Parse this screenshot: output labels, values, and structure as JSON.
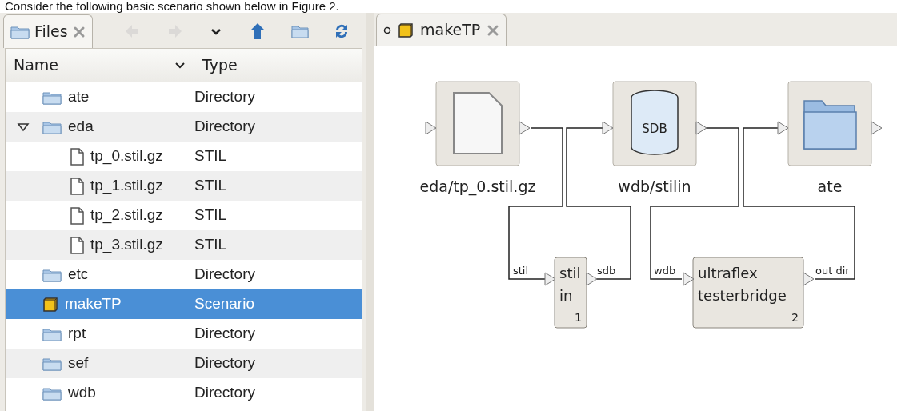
{
  "caption": "Consider the following basic scenario shown below in Figure 2.",
  "files_panel": {
    "tab": {
      "label": "Files"
    },
    "toolbar": [
      {
        "kind": "back",
        "disabled": true
      },
      {
        "kind": "forward",
        "disabled": true
      },
      {
        "kind": "dropdown",
        "disabled": false
      },
      {
        "kind": "up",
        "disabled": false
      },
      {
        "kind": "folder",
        "disabled": false
      },
      {
        "kind": "refresh",
        "disabled": false
      }
    ],
    "columns": [
      "Name",
      "Type"
    ],
    "rows": [
      {
        "name": "ate",
        "type": "Directory",
        "kind": "folder",
        "selected": false
      },
      {
        "name": "eda",
        "type": "Directory",
        "kind": "folder",
        "selected": false,
        "expanded": true,
        "children": [
          {
            "name": "tp_0.stil.gz",
            "type": "STIL",
            "kind": "file",
            "selected": false
          },
          {
            "name": "tp_1.stil.gz",
            "type": "STIL",
            "kind": "file",
            "selected": false
          },
          {
            "name": "tp_2.stil.gz",
            "type": "STIL",
            "kind": "file",
            "selected": false
          },
          {
            "name": "tp_3.stil.gz",
            "type": "STIL",
            "kind": "file",
            "selected": false
          }
        ]
      },
      {
        "name": "etc",
        "type": "Directory",
        "kind": "folder",
        "selected": false
      },
      {
        "name": "makeTP",
        "type": "Scenario",
        "kind": "scenario",
        "selected": true
      },
      {
        "name": "rpt",
        "type": "Directory",
        "kind": "folder",
        "selected": false
      },
      {
        "name": "sef",
        "type": "Directory",
        "kind": "folder",
        "selected": false
      },
      {
        "name": "wdb",
        "type": "Directory",
        "kind": "folder",
        "selected": false
      }
    ]
  },
  "editor": {
    "tab": {
      "label": "makeTP"
    },
    "nodes": [
      {
        "label": "eda/tp_0.stil.gz",
        "kind": "file"
      },
      {
        "label": "wdb/stilin",
        "kind": "database",
        "icon_text": "SDB"
      },
      {
        "label": "ate",
        "kind": "folder"
      }
    ],
    "blocks": [
      {
        "lines": [
          "stil",
          "in"
        ],
        "number": "1",
        "input": "stil",
        "output": "sdb"
      },
      {
        "lines": [
          "ultraflex",
          "testerbridge"
        ],
        "number": "2",
        "input": "wdb",
        "output": "out dir"
      }
    ]
  }
}
